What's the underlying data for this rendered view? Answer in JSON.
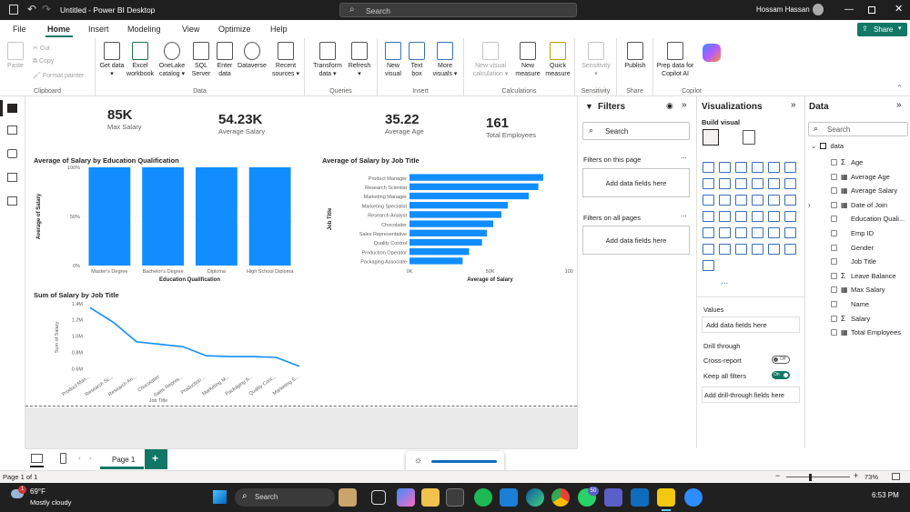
{
  "titlebar": {
    "title": "Untitled - Power BI Desktop",
    "search": "Search",
    "user": "Hossam Hassan"
  },
  "menu": [
    "File",
    "Home",
    "Insert",
    "Modeling",
    "View",
    "Optimize",
    "Help"
  ],
  "share": "Share",
  "ribbon": {
    "clipboard": {
      "label": "Clipboard",
      "paste": "Paste",
      "cut": "Cut",
      "copy": "Copy",
      "format_painter": "Format painter"
    },
    "data": {
      "label": "Data",
      "get_data": "Get data",
      "excel": "Excel workbook",
      "onelake": "OneLake catalog",
      "sql": "SQL Server",
      "enter": "Enter data",
      "dataverse": "Dataverse",
      "recent": "Recent sources"
    },
    "queries": {
      "label": "Queries",
      "transform": "Transform data",
      "refresh": "Refresh"
    },
    "insert": {
      "label": "Insert",
      "new_visual": "New visual",
      "text_box": "Text box",
      "more_visuals": "More visuals"
    },
    "calc": {
      "label": "Calculations",
      "new_visual_calc": "New visual calculation",
      "new_measure": "New measure",
      "quick_measure": "Quick measure"
    },
    "sens": {
      "label": "Sensitivity",
      "sensitivity": "Sensitivity"
    },
    "share": {
      "label": "Share",
      "publish": "Publish"
    },
    "copilot": {
      "label": "Copilot",
      "prep": "Prep data for Copilot AI"
    }
  },
  "kpis": [
    {
      "value": "85K",
      "label": "Max Salary"
    },
    {
      "value": "54.23K",
      "label": "Average Salary"
    },
    {
      "value": "35.22",
      "label": "Average Age"
    },
    {
      "value": "161",
      "label": "Total Employees"
    }
  ],
  "chart_data": [
    {
      "type": "bar",
      "title": "Average of Salary by Education Qualification",
      "xlabel": "Education Qualification",
      "ylabel": "Average of Salary",
      "categories": [
        "Master's Degree",
        "Bachelor's Degree",
        "Diploma",
        "High School Diploma"
      ],
      "values": [
        100,
        100,
        100,
        100
      ],
      "yticks": [
        "0%",
        "50%",
        "100%"
      ],
      "ylim": [
        0,
        100
      ]
    },
    {
      "type": "bar",
      "orientation": "horizontal",
      "title": "Average of Salary by Job Title",
      "xlabel": "Average of Salary",
      "ylabel": "Job Title",
      "categories": [
        "Product Manager",
        "Research Scientist",
        "Marketing Manager",
        "Marketing Specialist",
        "Research Analyst",
        "Chocolatier",
        "Sales Representative",
        "Quality Control",
        "Production Operator",
        "Packaging Associate"
      ],
      "values": [
        83000,
        80000,
        74000,
        61000,
        57000,
        52000,
        48000,
        45000,
        37000,
        33000
      ],
      "xticks": [
        "0K",
        "50K",
        "100K"
      ],
      "xlim": [
        0,
        100000
      ]
    },
    {
      "type": "line",
      "title": "Sum of Salary by Job Title",
      "xlabel": "Job Title",
      "ylabel": "Sum of Salary",
      "categories": [
        "Product Man...",
        "Research Sc...",
        "Research An...",
        "Chocolatier",
        "Sales Repres...",
        "Production ...",
        "Marketing M...",
        "Packaging A...",
        "Quality Cont...",
        "Marketing S..."
      ],
      "values": [
        1350000,
        1170000,
        930000,
        900000,
        870000,
        760000,
        750000,
        750000,
        740000,
        630000
      ],
      "yticks": [
        "0.6M",
        "0.8M",
        "1.0M",
        "1.2M",
        "1.4M"
      ],
      "ylim": [
        550000,
        1420000
      ]
    }
  ],
  "filters": {
    "title": "Filters",
    "search": "Search",
    "on_page": "Filters on this page",
    "add1": "Add data fields here",
    "on_all": "Filters on all pages",
    "add2": "Add data fields here",
    "more": "..."
  },
  "viz": {
    "title": "Visualizations",
    "build": "Build visual",
    "values": "Values",
    "add_values": "Add data fields here",
    "drill": "Drill through",
    "cross": "Cross-report",
    "cross_state": "Off",
    "keep": "Keep all filters",
    "keep_state": "On",
    "add_drill": "Add drill-through fields here",
    "more": "..."
  },
  "datapane": {
    "title": "Data",
    "search": "Search",
    "table": "data",
    "fields": [
      {
        "name": "Age",
        "kind": "sigma"
      },
      {
        "name": "Average Age",
        "kind": "calc"
      },
      {
        "name": "Average Salary",
        "kind": "calc"
      },
      {
        "name": "Date of Join",
        "kind": "expand"
      },
      {
        "name": "Education Quali...",
        "kind": "none"
      },
      {
        "name": "Emp ID",
        "kind": "none"
      },
      {
        "name": "Gender",
        "kind": "none"
      },
      {
        "name": "Job Title",
        "kind": "none"
      },
      {
        "name": "Leave Balance",
        "kind": "sigma"
      },
      {
        "name": "Max Salary",
        "kind": "calc"
      },
      {
        "name": "Name",
        "kind": "none"
      },
      {
        "name": "Salary",
        "kind": "sigma"
      },
      {
        "name": "Total Employees",
        "kind": "calc"
      }
    ]
  },
  "pages": {
    "tab": "Page 1",
    "add": "+"
  },
  "status": {
    "page": "Page 1 of 1",
    "zoom": "73%"
  },
  "taskbar": {
    "temp": "69°F",
    "weather": "Mostly cloudy",
    "search": "Search",
    "time": "6:53 PM",
    "badge": "1",
    "notif": "50"
  },
  "colors": {
    "accent": "#118dff",
    "ribbon_green": "#117865",
    "taskbar": "#202020"
  }
}
